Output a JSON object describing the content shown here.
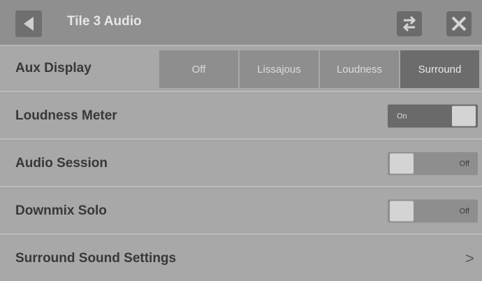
{
  "header": {
    "title": "Tile 3 Audio"
  },
  "rows": {
    "aux_display": {
      "label": "Aux Display",
      "options": [
        "Off",
        "Lissajous",
        "Loudness",
        "Surround"
      ],
      "selected": "Surround"
    },
    "loudness_meter": {
      "label": "Loudness Meter",
      "state": "On"
    },
    "audio_session": {
      "label": "Audio Session",
      "state": "Off"
    },
    "downmix_solo": {
      "label": "Downmix Solo",
      "state": "Off"
    },
    "surround_settings": {
      "label": "Surround Sound Settings",
      "chevron": ">"
    }
  },
  "icons": {
    "back": "back-arrow-icon",
    "swap": "swap-arrows-icon",
    "close": "close-x-icon"
  },
  "colors": {
    "header_bg": "#8f8f8f",
    "row_bg": "#a8a8a8",
    "active_segment": "#6c6c6c",
    "toggle_on": "#6a6a6a"
  }
}
